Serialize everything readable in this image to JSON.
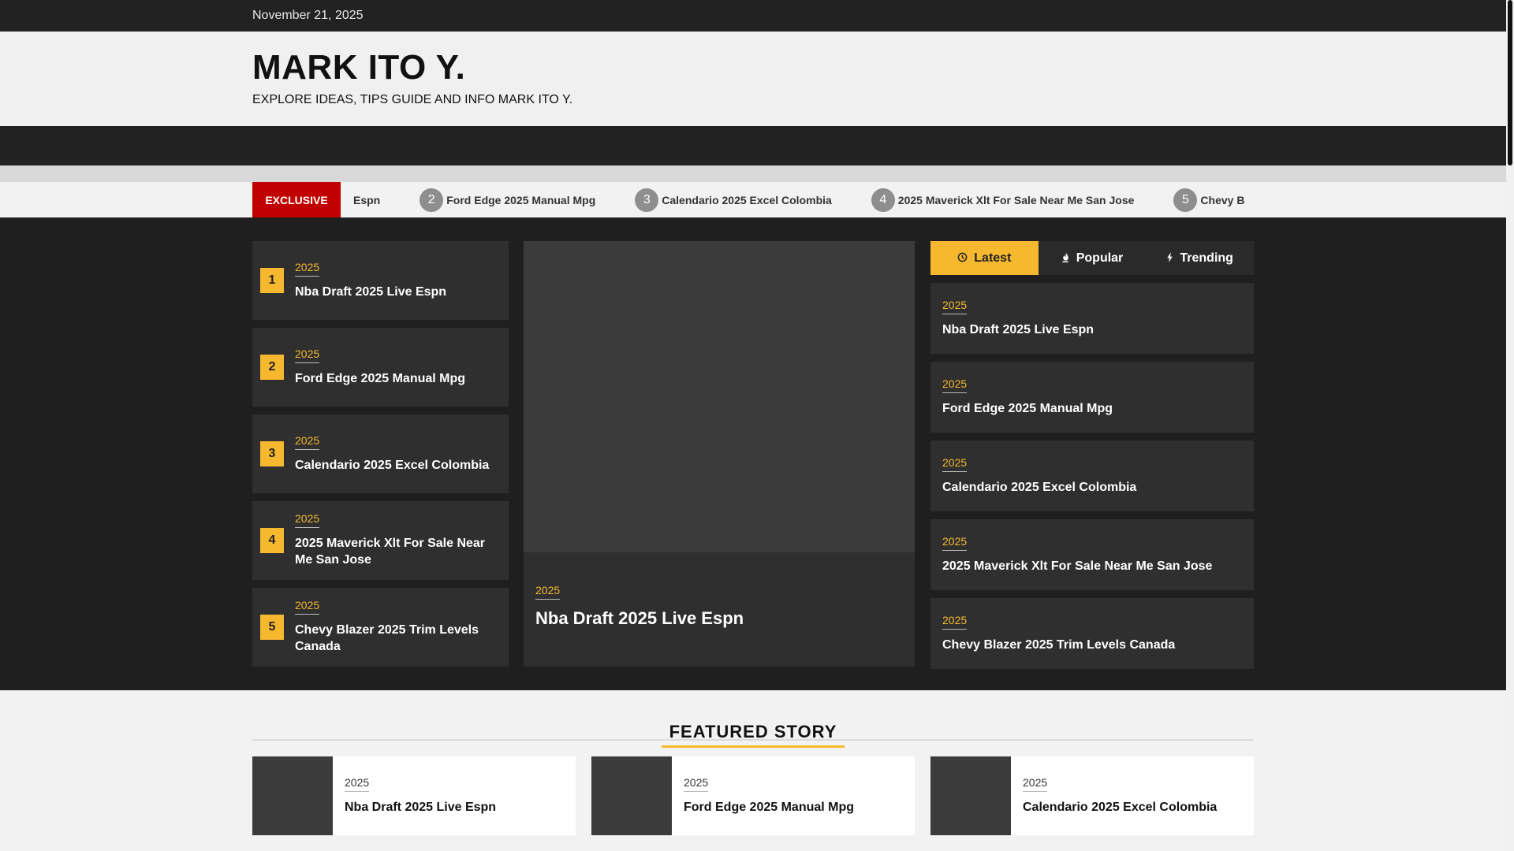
{
  "topbar": {
    "date": "November 21, 2025"
  },
  "site": {
    "title": "MARK ITO Y.",
    "tagline": "EXPLORE IDEAS, TIPS GUIDE AND INFO MARK ITO Y."
  },
  "ticker": {
    "label": "EXCLUSIVE",
    "first_partial": "Espn",
    "items": [
      {
        "num": "2",
        "title": "Ford Edge 2025 Manual Mpg"
      },
      {
        "num": "3",
        "title": "Calendario 2025 Excel Colombia"
      },
      {
        "num": "4",
        "title": "2025 Maverick Xlt For Sale Near Me San Jose"
      },
      {
        "num": "5",
        "title": "Chevy B"
      }
    ]
  },
  "left_list": [
    {
      "num": "1",
      "category": "2025",
      "title": "Nba Draft 2025 Live Espn"
    },
    {
      "num": "2",
      "category": "2025",
      "title": "Ford Edge 2025 Manual Mpg"
    },
    {
      "num": "3",
      "category": "2025",
      "title": "Calendario 2025 Excel Colombia"
    },
    {
      "num": "4",
      "category": "2025",
      "title": "2025 Maverick Xlt For Sale Near Me San Jose"
    },
    {
      "num": "5",
      "category": "2025",
      "title": "Chevy Blazer 2025 Trim Levels Canada"
    }
  ],
  "main_feature": {
    "category": "2025",
    "title": "Nba Draft 2025 Live Espn"
  },
  "tabs": [
    {
      "label": "Latest",
      "icon": "clock-icon",
      "active": true
    },
    {
      "label": "Popular",
      "icon": "flame-icon",
      "active": false
    },
    {
      "label": "Trending",
      "icon": "bolt-icon",
      "active": false
    }
  ],
  "latest_list": [
    {
      "category": "2025",
      "title": "Nba Draft 2025 Live Espn"
    },
    {
      "category": "2025",
      "title": "Ford Edge 2025 Manual Mpg"
    },
    {
      "category": "2025",
      "title": "Calendario 2025 Excel Colombia"
    },
    {
      "category": "2025",
      "title": "2025 Maverick Xlt For Sale Near Me San Jose"
    },
    {
      "category": "2025",
      "title": "Chevy Blazer 2025 Trim Levels Canada"
    }
  ],
  "featured": {
    "heading": "FEATURED STORY",
    "cards": [
      {
        "category": "2025",
        "title": "Nba Draft 2025 Live Espn"
      },
      {
        "category": "2025",
        "title": "Ford Edge 2025 Manual Mpg"
      },
      {
        "category": "2025",
        "title": "Calendario 2025 Excel Colombia"
      }
    ]
  },
  "colors": {
    "accent": "#f5b82e",
    "exclusive": "#c10000",
    "dark": "#1f1f1f",
    "card": "#2f2f2f"
  }
}
